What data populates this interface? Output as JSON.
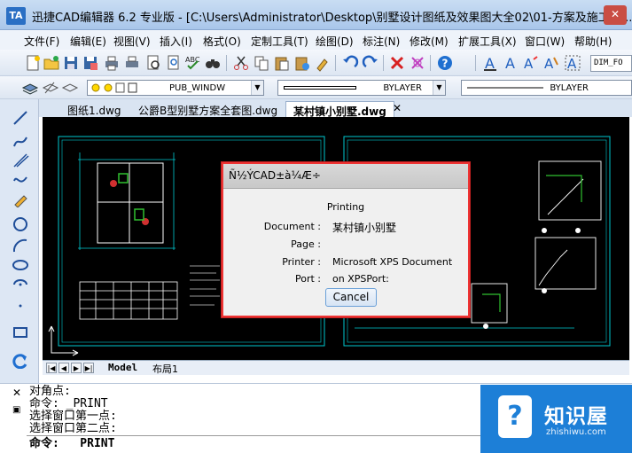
{
  "window": {
    "title": "迅捷CAD编辑器 6.2 专业版  - [C:\\Users\\Administrator\\Desktop\\别墅设计图纸及效果图大全02\\01-方案及施工图\\...",
    "icon_label": "TA",
    "close_glyph": "✕"
  },
  "menu": [
    "文件(F)",
    "编辑(E)",
    "视图(V)",
    "插入(I)",
    "格式(O)",
    "定制工具(T)",
    "绘图(D)",
    "标注(N)",
    "修改(M)",
    "扩展工具(X)",
    "窗口(W)",
    "帮助(H)"
  ],
  "toolbar": {
    "dim_style": "DIM_FO"
  },
  "properties": {
    "layer": "PUB_WINDW",
    "linetype": "BYLAYER",
    "lineweight": "BYLAYER"
  },
  "tabs": [
    {
      "label": "图纸1.dwg",
      "active": false
    },
    {
      "label": "公爵B型别墅方案全套图.dwg",
      "active": false
    },
    {
      "label": "某村镇小别墅.dwg",
      "active": true
    }
  ],
  "tab_close": "✕",
  "layout_tabs": [
    "Model",
    "布局1"
  ],
  "layout_nav": [
    "|◀",
    "◀",
    "▶",
    "▶|"
  ],
  "command": {
    "lines": [
      "对角点:",
      "命令: _PRINT",
      "选择窗口第一点:",
      "选择窗口第二点:"
    ],
    "prompt": "命令:   PRINT",
    "close_glyph": "✕"
  },
  "dialog": {
    "title": "Ñ½ÝCAD±à¼­Æ÷",
    "status": "Printing",
    "fields": [
      {
        "label": "Document :",
        "value": "某村镇小别墅"
      },
      {
        "label": "Page :",
        "value": ""
      },
      {
        "label": "Printer :",
        "value": "Microsoft XPS Document"
      },
      {
        "label": "Port :",
        "value": "on XPSPort:"
      }
    ],
    "cancel_label": "Cancel"
  },
  "watermark": {
    "name": "知识屋",
    "url": "zhishiwu.com",
    "badge": "?"
  },
  "colors": {
    "canvas_bg": "#000000",
    "frame_cyan": "#00c8d0",
    "drawing_white": "#ffffff",
    "dialog_border": "#e33333",
    "logo_blue": "#1d7fd7"
  }
}
